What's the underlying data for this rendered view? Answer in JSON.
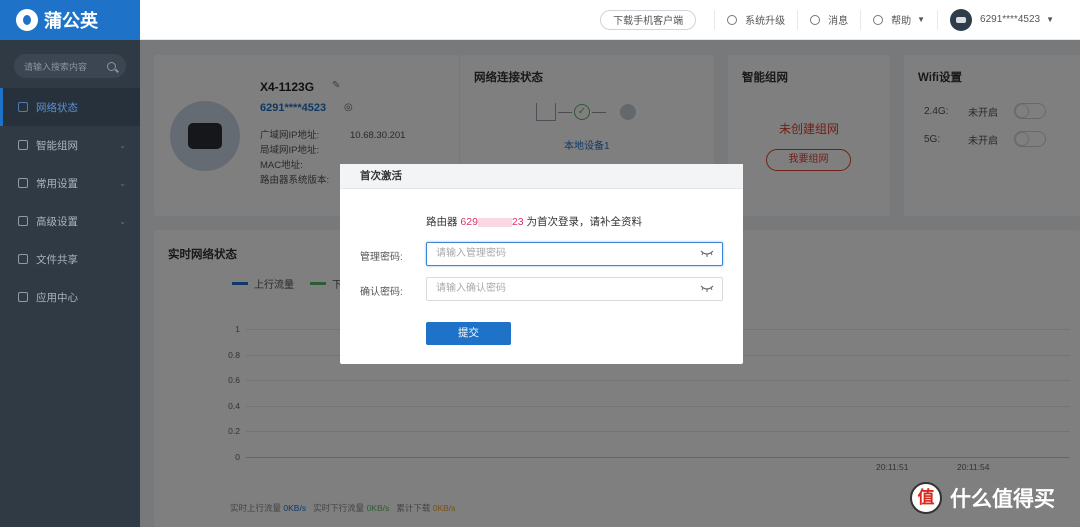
{
  "app": {
    "logo_text": "蒲公英"
  },
  "sidebar": {
    "search_placeholder": "请输入搜索内容",
    "items": [
      {
        "label": "网络状态",
        "icon": "home-icon"
      },
      {
        "label": "智能组网",
        "icon": "mesh-icon"
      },
      {
        "label": "常用设置",
        "icon": "gear-icon"
      },
      {
        "label": "高级设置",
        "icon": "settings-icon"
      },
      {
        "label": "文件共享",
        "icon": "folder-icon"
      },
      {
        "label": "应用中心",
        "icon": "apps-icon"
      }
    ]
  },
  "topbar": {
    "download_label": "下载手机客户端",
    "upgrade_label": "系统升级",
    "messages_label": "消息",
    "help_label": "帮助",
    "user_label": "6291****4523"
  },
  "device": {
    "name": "X4-1123G",
    "sn": "6291****4523",
    "rows": [
      {
        "label": "广域网IP地址:",
        "value": "10.68.30.201"
      },
      {
        "label": "局域网IP地址:",
        "value": ""
      },
      {
        "label": "MAC地址:",
        "value": ""
      },
      {
        "label": "路由器系统版本:",
        "value": ""
      }
    ]
  },
  "network": {
    "title": "网络连接状态",
    "device_label": "本地设备1"
  },
  "mesh": {
    "title": "智能组网",
    "status": "未创建组网",
    "button": "我要组网"
  },
  "wifi": {
    "title": "Wifi设置",
    "bands": [
      {
        "band": "2.4G:",
        "status": "未开启",
        "enabled": false
      },
      {
        "band": "5G:",
        "status": "未开启",
        "enabled": false
      }
    ]
  },
  "traffic": {
    "title": "实时网络状态",
    "legend_up": "上行流量",
    "legend_down": "下",
    "y_ticks": [
      "1",
      "0.8",
      "0.6",
      "0.4",
      "0.2",
      "0"
    ],
    "x_ticks": [
      "20:11:51",
      "20:11:54"
    ],
    "stats": {
      "up_label": "实时上行流量",
      "up_value": "0KB/s",
      "down_label": "实时下行流量",
      "down_value": "0KB/s",
      "total_label": "累计下载",
      "total_value": "0KB/s"
    },
    "colors": {
      "up": "#1e73c8",
      "down": "#5cb85c"
    }
  },
  "modal": {
    "title": "首次激活",
    "msg_prefix": "路由器 ",
    "msg_sn_start": "629",
    "msg_sn_end": "23",
    "msg_suffix": " 为首次登录，请补全资料",
    "password_label": "管理密码:",
    "password_placeholder": "请输入管理密码",
    "confirm_label": "确认密码:",
    "confirm_placeholder": "请输入确认密码",
    "submit_label": "提交"
  },
  "watermark": {
    "badge": "值",
    "text": "什么值得买"
  }
}
